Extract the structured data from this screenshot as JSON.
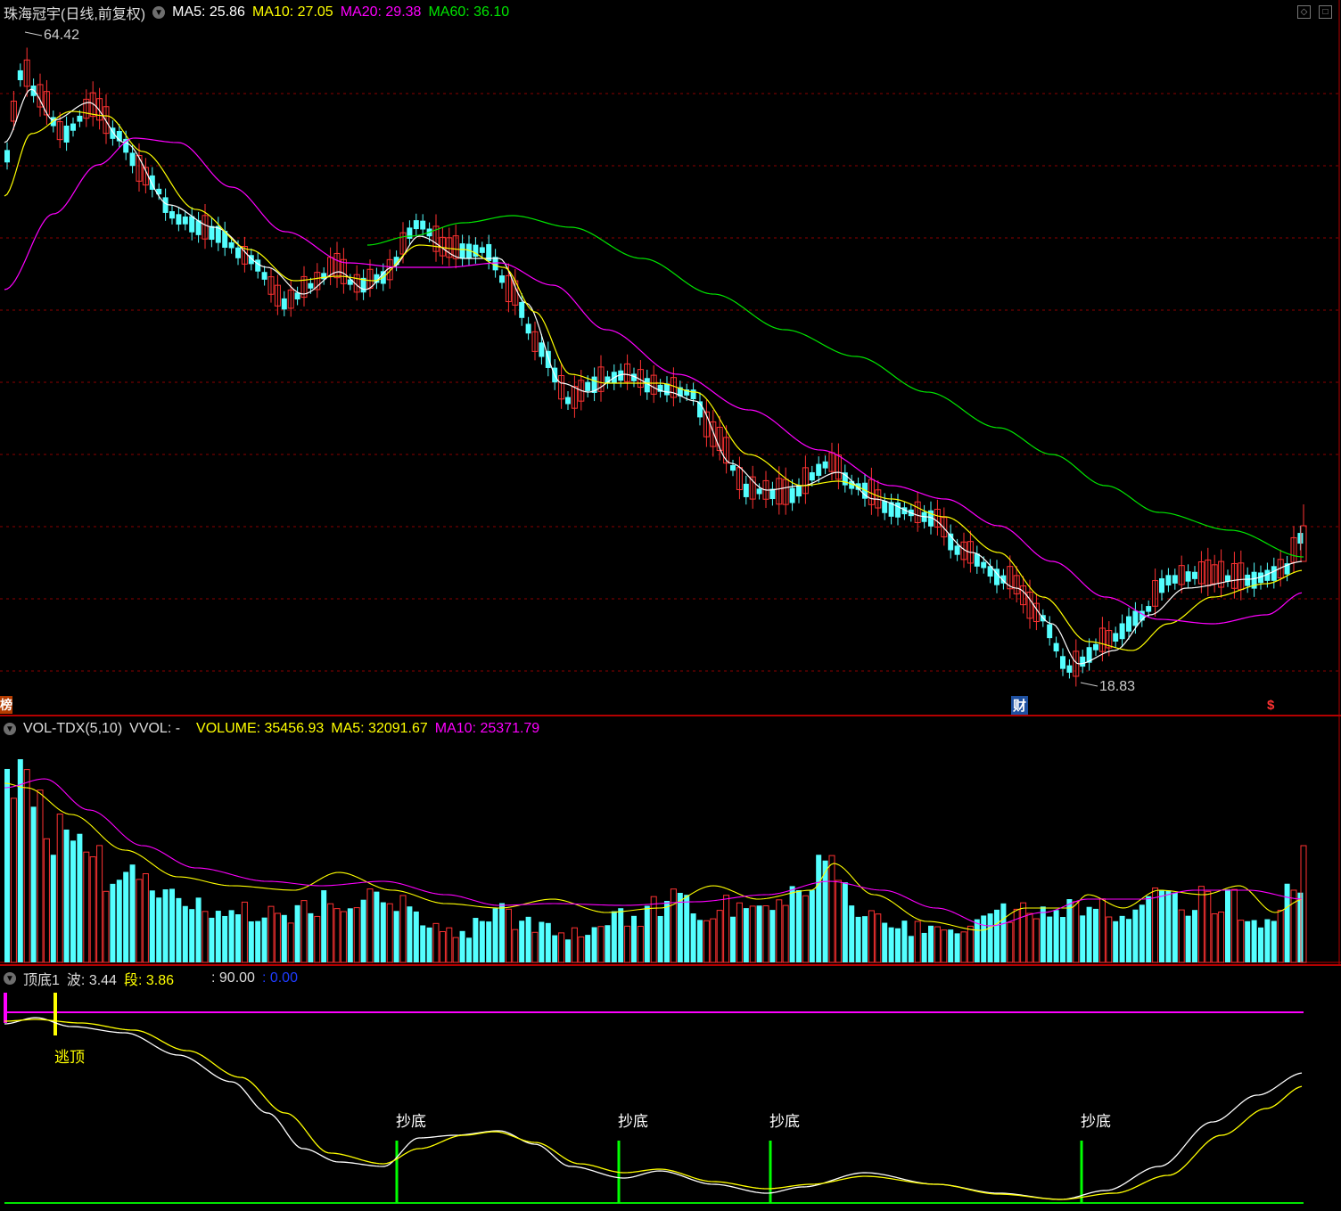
{
  "price_panel": {
    "title": "珠海冠宇(日线,前复权)",
    "ma": [
      {
        "label": "MA5:",
        "value": "25.86",
        "color": "#ffffff"
      },
      {
        "label": "MA10:",
        "value": "27.05",
        "color": "#ffff00"
      },
      {
        "label": "MA20:",
        "value": "29.38",
        "color": "#ff00ff"
      },
      {
        "label": "MA60:",
        "value": "36.10",
        "color": "#00e600"
      }
    ],
    "high_label": "64.42",
    "low_label": "18.83",
    "left_marker": "榜",
    "finance_marker": "财",
    "dollar_marker": "$"
  },
  "volume_panel": {
    "name": "VOL-TDX(5,10)",
    "vvol": "VVOL: -",
    "volume": "VOLUME: 35456.93",
    "ma5": "MA5: 32091.67",
    "ma10": "MA10: 25371.79"
  },
  "indicator_panel": {
    "name": "顶底1",
    "wave_label": "波:",
    "wave_value": "3.44",
    "seg_label": "段:",
    "seg_value": "3.86",
    "level_label": ": 90.00",
    "zero_label": ": 0.00",
    "top_signal": "逃顶",
    "bottom_signal": "抄底"
  },
  "colors": {
    "up": "#ff3232",
    "down": "#54ffff",
    "ma5": "#ffffff",
    "ma10": "#ffff00",
    "ma20": "#ff00ff",
    "ma60": "#00e600",
    "grid": "#8b0000"
  }
}
